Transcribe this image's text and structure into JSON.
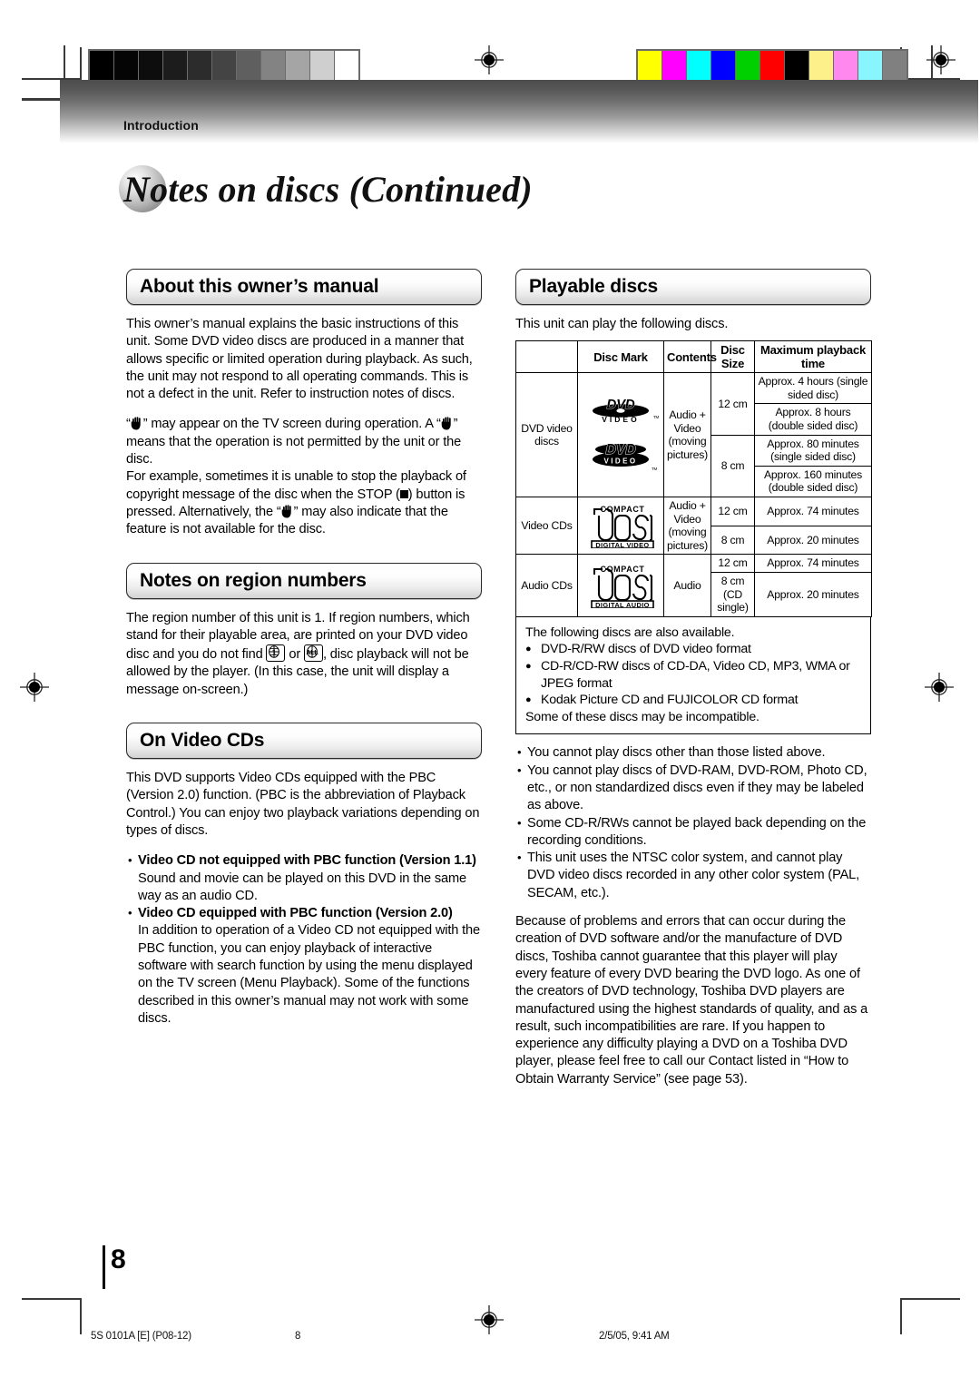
{
  "header": {
    "section_label": "Introduction",
    "page_title": "Notes on discs (Continued)"
  },
  "left_column": {
    "section1": {
      "heading": "About this owner’s manual",
      "para1": "This owner’s manual explains the basic instructions of this unit. Some DVD video discs are produced in a manner that allows specific or limited operation during playback. As such, the unit may not respond to all operating commands. This is not a defect in the unit. Refer to instruction notes of discs.",
      "para2_a": "“",
      "para2_b": "” may appear on the TV screen during operation. A “",
      "para2_c": "” means that the operation is not permitted by the unit or the disc.",
      "para3_a": "For example, sometimes it is unable to stop the playback of copyright message of the disc when the STOP (",
      "para3_b": ") button is pressed. Alternatively, the “",
      "para3_c": "” may also indicate that the feature is not available for the disc."
    },
    "section2": {
      "heading": "Notes on region numbers",
      "para_a": "The region number of this unit is 1. If region numbers, which stand for their playable area, are printed on your DVD video disc and you do not find",
      "para_b": "or",
      "para_c": ", disc playback will not be allowed by the player. (In this case, the unit will display a message on-screen.)",
      "icon1_label": "1",
      "icon2_label": "ALL"
    },
    "section3": {
      "heading": "On Video CDs",
      "para1": "This DVD supports Video CDs equipped with the PBC (Version 2.0) function. (PBC is the abbreviation of Playback Control.) You can enjoy two playback variations depending on types of discs.",
      "bullets": [
        {
          "title": "Video CD not equipped with PBC function (Version 1.1)",
          "body": "Sound and movie can be played on this DVD in the same way as an audio CD."
        },
        {
          "title": "Video CD equipped with PBC function (Version 2.0)",
          "body": "In addition to operation of a Video CD not equipped with the PBC function, you can enjoy playback of interactive software with search function by using the menu displayed on the TV screen (Menu Playback). Some of the functions described in this owner’s manual may not work with some discs."
        }
      ]
    }
  },
  "right_column": {
    "heading": "Playable discs",
    "intro": "This unit can play the following discs.",
    "table": {
      "columns": [
        "",
        "Disc Mark",
        "Contents",
        "Disc Size",
        "Maximum playback time"
      ],
      "rows": [
        {
          "category": "DVD video discs",
          "mark": "dvd-video-logo",
          "contents": "Audio + Video (moving pictures)",
          "sizes": [
            {
              "size": "12 cm",
              "times": [
                "Approx. 4 hours (single sided disc)",
                "Approx. 8 hours (double sided disc)"
              ]
            },
            {
              "size": "8 cm",
              "times": [
                "Approx. 80 minutes (single sided disc)",
                "Approx. 160 minutes (double sided disc)"
              ]
            }
          ]
        },
        {
          "category": "Video CDs",
          "mark": "compact-disc-digital-video-logo",
          "contents": "Audio + Video (moving pictures)",
          "sizes": [
            {
              "size": "12 cm",
              "times": [
                "Approx. 74 minutes"
              ]
            },
            {
              "size": "8 cm",
              "times": [
                "Approx. 20 minutes"
              ]
            }
          ]
        },
        {
          "category": "Audio CDs",
          "mark": "compact-disc-digital-audio-logo",
          "contents": "Audio",
          "sizes": [
            {
              "size": "12 cm",
              "times": [
                "Approx. 74 minutes"
              ]
            },
            {
              "size": "8 cm (CD single)",
              "times": [
                "Approx. 20 minutes"
              ]
            }
          ]
        }
      ]
    },
    "also_box": {
      "lead": "The following discs are also available.",
      "items": [
        "DVD-R/RW discs of DVD video format",
        "CD-R/CD-RW discs of CD-DA, Video CD, MP3, WMA or JPEG format",
        "Kodak Picture CD and FUJICOLOR CD format"
      ],
      "footer": "Some of these discs may be incompatible."
    },
    "cautions": [
      "You cannot play discs other than those listed above.",
      "You cannot play discs of DVD-RAM, DVD-ROM, Photo CD, etc., or non standardized discs even if they may be labeled as above.",
      "Some CD-R/RWs cannot be played back depending on the recording conditions.",
      "This unit uses the NTSC color system, and cannot play DVD video discs recorded in any other color system (PAL, SECAM, etc.)."
    ],
    "closing": "Because of problems and errors that can occur during the creation of DVD software and/or the manufacture of DVD discs, Toshiba cannot guarantee that this player will play every feature of every DVD bearing the DVD logo.  As one of the creators of DVD technology, Toshiba DVD players are manufactured using the highest standards of quality, and as a result, such incompatibilities are rare. If you happen to experience any difficulty playing a DVD on a Toshiba DVD player, please feel free to call our Contact listed in “How to Obtain Warranty Service” (see page 53)."
  },
  "logos": {
    "dvd_video_top_word": "DVD",
    "dvd_video_top_sub": "V I D E O",
    "dvd_video_bottom_word": "DVD",
    "dvd_video_bottom_sub": "VIDEO",
    "tm": "TM",
    "compact": "COMPACT",
    "disc": "disc",
    "digital_video": "DIGITAL VIDEO",
    "digital_audio": "DIGITAL AUDIO"
  },
  "footer": {
    "page_number": "8",
    "job_code": "5S 0101A [E] (P08-12)",
    "folio": "8",
    "timestamp": "2/5/05, 9:41 AM"
  },
  "print_marks": {
    "grayscale_steps": [
      "#000000",
      "#050505",
      "#0d0d0d",
      "#1c1c1c",
      "#2c2c2c",
      "#444444",
      "#5f5f5f",
      "#838383",
      "#a5a5a5",
      "#cfcfcf",
      "#ffffff"
    ],
    "color_steps": [
      "#ffff00",
      "#ff00ff",
      "#00ffff",
      "#0000ff",
      "#00d000",
      "#ff0000",
      "#000000",
      "#fdf08a",
      "#ff88ee",
      "#88f5ff",
      "#808080"
    ]
  }
}
